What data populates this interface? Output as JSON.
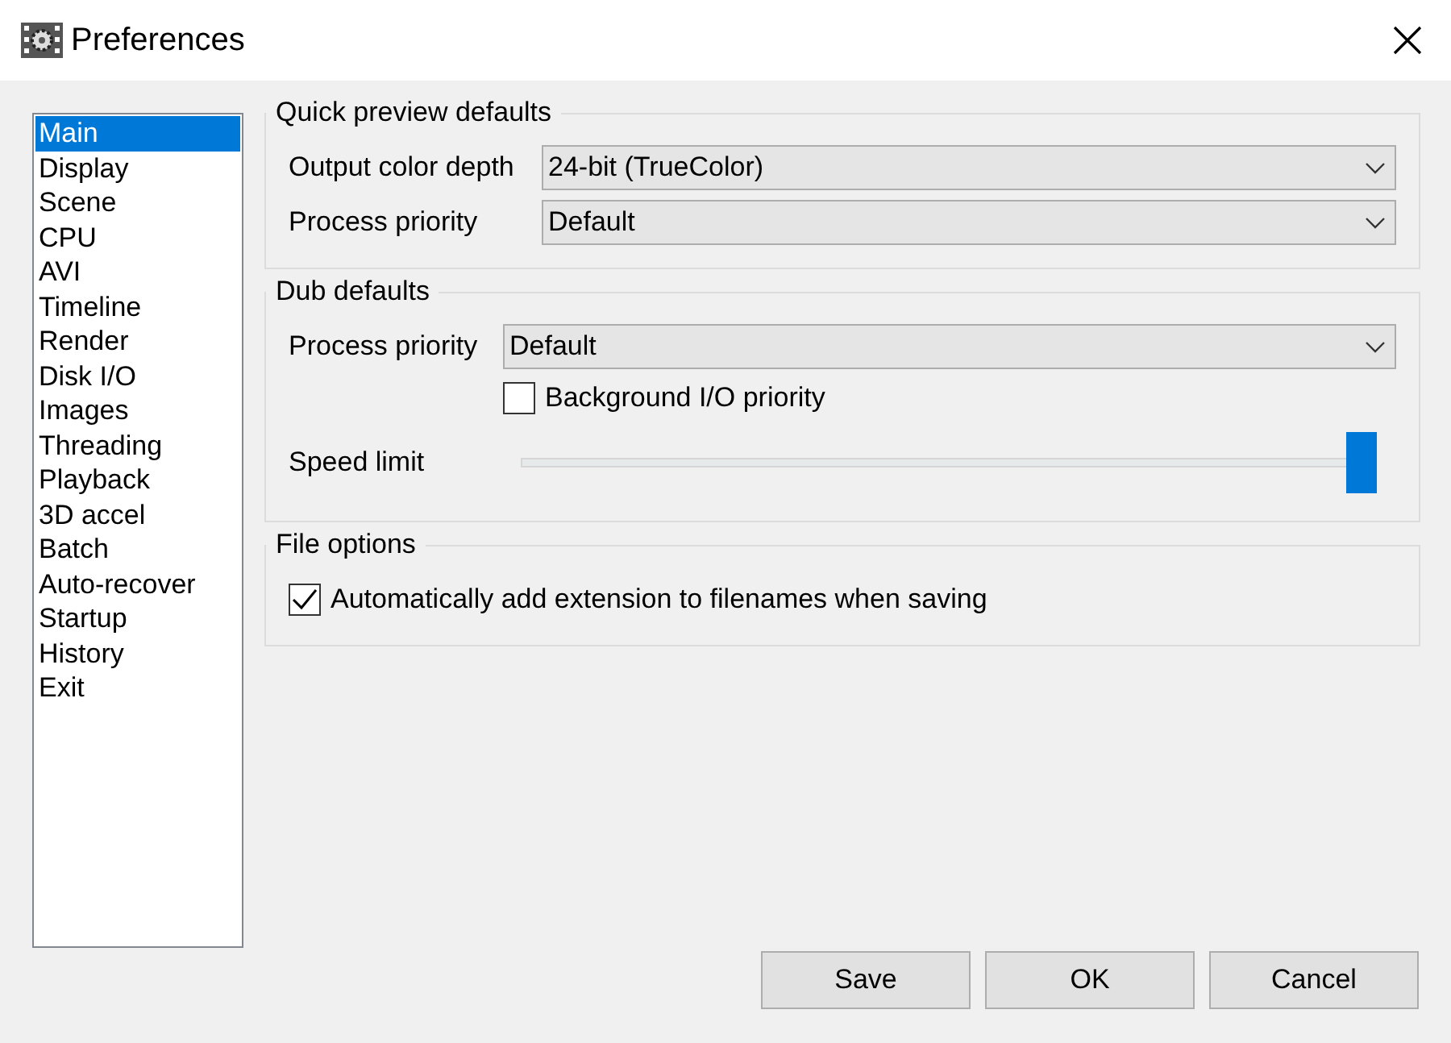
{
  "window": {
    "title": "Preferences"
  },
  "sidebar": {
    "items": [
      {
        "label": "Main",
        "selected": true
      },
      {
        "label": "Display",
        "selected": false
      },
      {
        "label": "Scene",
        "selected": false
      },
      {
        "label": "CPU",
        "selected": false
      },
      {
        "label": "AVI",
        "selected": false
      },
      {
        "label": "Timeline",
        "selected": false
      },
      {
        "label": "Render",
        "selected": false
      },
      {
        "label": "Disk I/O",
        "selected": false
      },
      {
        "label": "Images",
        "selected": false
      },
      {
        "label": "Threading",
        "selected": false
      },
      {
        "label": "Playback",
        "selected": false
      },
      {
        "label": "3D accel",
        "selected": false
      },
      {
        "label": "Batch",
        "selected": false
      },
      {
        "label": "Auto-recover",
        "selected": false
      },
      {
        "label": "Startup",
        "selected": false
      },
      {
        "label": "History",
        "selected": false
      },
      {
        "label": "Exit",
        "selected": false
      }
    ]
  },
  "groups": [
    {
      "title": "Quick preview defaults",
      "rows": [
        {
          "kind": "dropdown",
          "label": "Output color depth",
          "value": "24-bit (TrueColor)"
        },
        {
          "kind": "dropdown",
          "label": "Process priority",
          "value": "Default"
        }
      ]
    },
    {
      "title": "Dub defaults",
      "rows": [
        {
          "kind": "dropdown",
          "label": "Process priority",
          "value": "Default"
        },
        {
          "kind": "checkbox",
          "label": "Background I/O priority",
          "checked": false
        },
        {
          "kind": "slider",
          "label": "Speed limit",
          "level": 1
        }
      ]
    },
    {
      "title": "File options",
      "rows": [
        {
          "kind": "checkbox",
          "label": "Automatically add extension to filenames when saving",
          "checked": true
        }
      ]
    }
  ],
  "buttons": [
    "Save",
    "OK",
    "Cancel"
  ]
}
